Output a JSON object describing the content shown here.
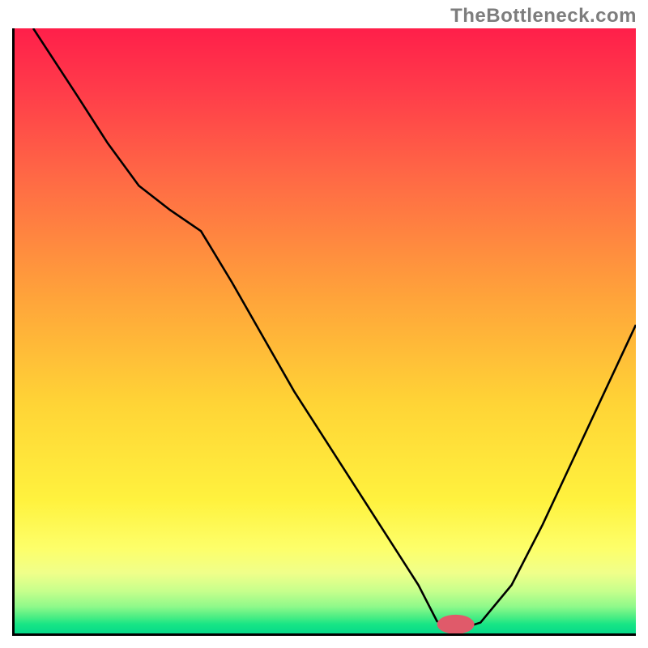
{
  "watermark": "TheBottleneck.com",
  "chart_data": {
    "type": "line",
    "title": "",
    "xlabel": "",
    "ylabel": "",
    "xlim": [
      0,
      100
    ],
    "ylim": [
      0,
      100
    ],
    "background": "red-yellow-green-gradient",
    "marker": {
      "x": 71,
      "y": 1.5,
      "color": "#e05a6a",
      "rx": 3,
      "ry": 1.6
    },
    "series": [
      {
        "name": "curve",
        "color": "#000000",
        "x": [
          3,
          10,
          15,
          20,
          25,
          30,
          35,
          40,
          45,
          50,
          55,
          60,
          65,
          68,
          72,
          75,
          80,
          85,
          90,
          95,
          100
        ],
        "y": [
          100,
          89,
          81,
          74,
          70,
          66.5,
          58,
          49,
          40,
          32,
          24,
          16,
          8,
          2,
          0.8,
          1.8,
          8,
          18,
          29,
          40,
          51
        ]
      }
    ]
  },
  "gradient_stops": [
    {
      "offset": 0.0,
      "color": "#ff1f4a"
    },
    {
      "offset": 0.1,
      "color": "#ff3b4a"
    },
    {
      "offset": 0.25,
      "color": "#ff6a45"
    },
    {
      "offset": 0.45,
      "color": "#ffa53a"
    },
    {
      "offset": 0.62,
      "color": "#ffd436"
    },
    {
      "offset": 0.78,
      "color": "#fff23e"
    },
    {
      "offset": 0.86,
      "color": "#fdff6a"
    },
    {
      "offset": 0.9,
      "color": "#f0ff8a"
    },
    {
      "offset": 0.93,
      "color": "#c7ff8c"
    },
    {
      "offset": 0.956,
      "color": "#8ef98a"
    },
    {
      "offset": 0.972,
      "color": "#4eee84"
    },
    {
      "offset": 0.985,
      "color": "#17e585"
    },
    {
      "offset": 1.0,
      "color": "#06d989"
    }
  ]
}
